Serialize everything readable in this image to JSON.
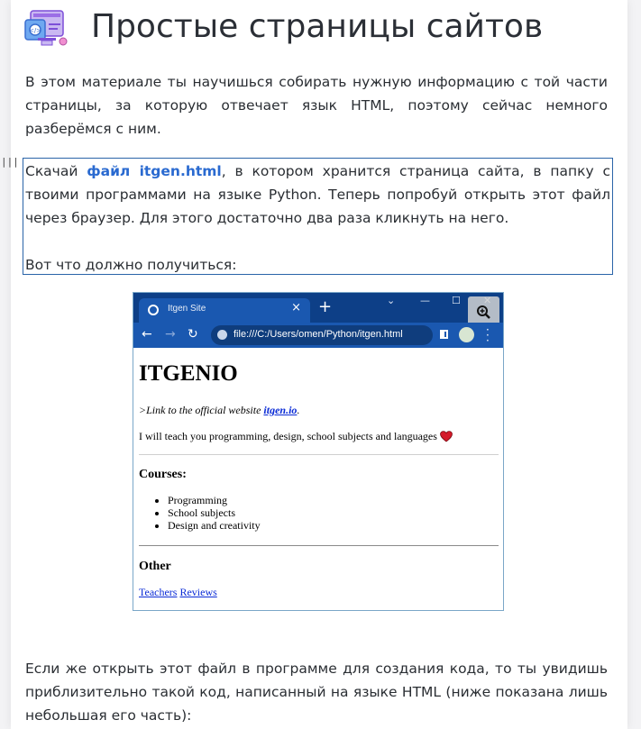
{
  "header": {
    "title": "Простые страницы сайтов",
    "logo_icon": "web-development-icon"
  },
  "intro": {
    "text": "В этом материале ты научишься собирать нужную информацию с той части страницы, за которую отвечает язык HTML, поэтому сейчас немного разберёмся с ним."
  },
  "block": {
    "handle": "|||",
    "before_link": "Скачай ",
    "link_label": "файл itgen.html",
    "after_link": ", в котором хранится страница сайта, в папку с твоими программами на языке Python. Теперь попробуй открыть этот файл через браузер. Для этого достаточно два раза кликнуть на него.",
    "result_text": "Вот что должно получиться:"
  },
  "browser": {
    "tab_title": "Itgen Site",
    "url": "file:///C:/Users/omen/Python/itgen.html",
    "zoom_icon": "zoom-in-icon",
    "page": {
      "heading": "ITGENIO",
      "link_prefix": ">Link to the official website ",
      "link_label": "itgen.io",
      "link_suffix": ".",
      "teach_text": "I will teach you programming, design, school subjects and languages",
      "courses_heading": "Courses:",
      "courses": [
        "Programming",
        "School subjects",
        "Design and creativity"
      ],
      "other_heading": "Other",
      "other_links": [
        "Teachers",
        "Reviews"
      ]
    }
  },
  "outro": {
    "text": "Если же открыть этот файл в программе для создания кода, то ты увидишь приблизительно такой код, написанный на языке HTML (ниже показана лишь небольшая его часть):"
  }
}
